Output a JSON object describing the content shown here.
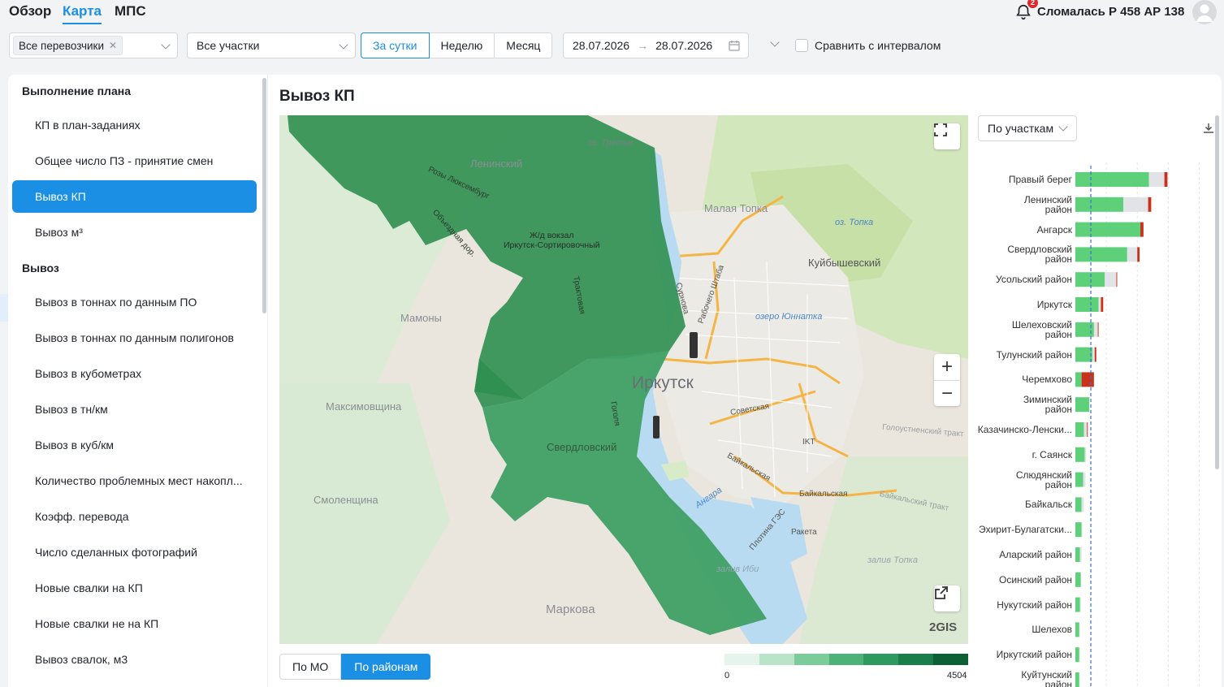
{
  "nav": {
    "tabs": [
      "Обзор",
      "Карта",
      "МПС"
    ],
    "active_tab": "Карта"
  },
  "header": {
    "notification_count": "2",
    "alert_text": "Сломалась Р 458 АР 138"
  },
  "filters": {
    "carriers_chip": "Все перевозчики",
    "sections": "Все участки",
    "periods": [
      "За сутки",
      "Неделю",
      "Месяц"
    ],
    "active_period": "За сутки",
    "date_from": "28.07.2026",
    "date_to": "28.07.2026",
    "compare_label": "Сравнить с интервалом"
  },
  "sidebar": {
    "group1": "Выполнение плана",
    "items1": [
      "КП в план-заданиях",
      "Общее число ПЗ - принятие смен",
      "Вывоз КП",
      "Вывоз м³"
    ],
    "group2": "Вывоз",
    "items2": [
      "Вывоз в тоннах по данным ПО",
      "Вывоз в тоннах по данным полигонов",
      "Вывоз в кубометрах",
      "Вывоз в тн/км",
      "Вывоз в куб/км",
      "Количество проблемных мест накопл...",
      "Коэфф. перевода",
      "Число сделанных фотографий",
      "Новые свалки на КП",
      "Новые свалки не на КП",
      "Вывоз свалок, м3"
    ],
    "active_item": "Вывоз КП"
  },
  "main": {
    "title": "Вывоз КП"
  },
  "map": {
    "labels": {
      "leninsky": "Ленинский",
      "station": "Ж/д вокзал\nИркутск-Сортировочный",
      "mamony": "Мамоны",
      "maksimovshchina": "Максимовщина",
      "smolenshchina": "Смоленщина",
      "sverdlovsky": "Свердловский",
      "markova": "Маркова",
      "malaya_topka": "Малая Топка",
      "kuibyshevsky": "Куйбышевский",
      "irkutsk": "Иркутск",
      "oz_topka": "оз. Топка",
      "oz_yunnatka": "озеро Юннатка",
      "oz_tretye": "оз. Третье",
      "angara": "Ангара",
      "raketa": "Ракета",
      "ikt": "IKT",
      "sovetskaya": "Советская",
      "baikalskaya": "Байкальская",
      "baikalskaya2": "Байкальская",
      "golousnenskiy": "Голоустненский тракт",
      "baikalsky_trakt": "Байкальский тракт",
      "plotina": "Плотина ГЭС",
      "rabochego_shtaba": "Рабочего Штаба",
      "surnova": "Сурнова",
      "traktovaya": "Трактовая",
      "gogolya": "Гоголя",
      "rozy": "Розы Люксембург",
      "obyezdnaya": "Объездная дор.",
      "zaliv_topka": "залив Топка",
      "zaliv_ibi": "залив Иби",
      "logo": "2GIS"
    }
  },
  "bottom": {
    "toggle": [
      "По МО",
      "По районам"
    ],
    "legend_min": "0",
    "legend_max": "4504",
    "legend_colors": [
      "#e6f5ec",
      "#b9e4c8",
      "#7ccb9a",
      "#4cb27a",
      "#2e9a60",
      "#1a7e4a",
      "#0d5f35"
    ]
  },
  "chart_panel": {
    "dropdown": "По участкам"
  },
  "chart_data": {
    "type": "bar",
    "orientation": "horizontal",
    "categories": [
      "Правый берег",
      "Ленинский\nрайон",
      "Ангарск",
      "Свердловский\nрайон",
      "Усольский район",
      "Иркутск",
      "Шелеховский\nрайон",
      "Тулунский район",
      "Черемхово",
      "Зиминский\nрайон",
      "Казачинско-Ленски...",
      "г. Саянск",
      "Слюдянский\nрайон",
      "Байкальск",
      "Эхирит-Булагатски...",
      "Аларский район",
      "Осинский район",
      "Нукутский район",
      "Шелехов",
      "Иркутский район",
      "Куйтунский\nрайон"
    ],
    "series": [
      {
        "values": [
          95,
          62,
          84,
          67,
          38,
          30,
          24,
          22,
          8,
          18,
          11,
          12,
          10,
          8,
          8,
          6,
          7,
          6,
          5,
          5,
          5
        ],
        "color": "#5fd07a"
      },
      {
        "values": [
          20,
          32,
          0,
          13,
          15,
          3,
          5,
          3,
          0,
          0,
          4,
          2,
          3,
          3,
          1,
          2,
          0,
          1,
          0,
          1,
          0
        ],
        "color": "#e1e3e6"
      },
      {
        "values": [
          4,
          4,
          4,
          3,
          1,
          3,
          1,
          2,
          16,
          0,
          1,
          0,
          0,
          0,
          0,
          0,
          0,
          0,
          0,
          0,
          0
        ],
        "color": "#c8321a"
      }
    ],
    "reference_line": 20,
    "xlim": [
      0,
      170
    ]
  }
}
